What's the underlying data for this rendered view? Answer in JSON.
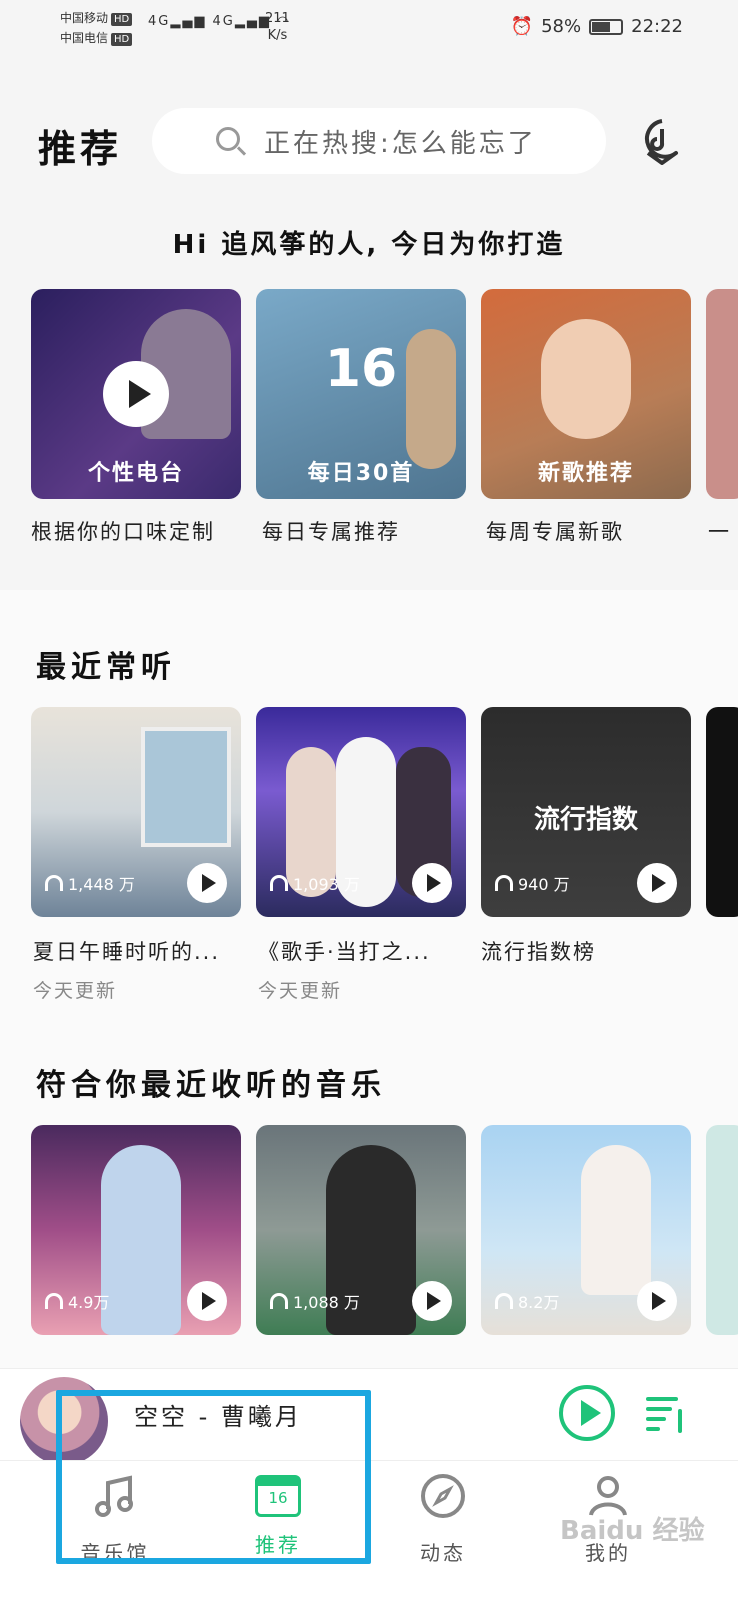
{
  "status_bar": {
    "carrier1": "中国移动",
    "carrier2": "中国电信",
    "hd": "HD",
    "net1": "4G",
    "net2": "4G",
    "speed_value": "211",
    "speed_unit": "K/s",
    "battery": "58%",
    "battery_level": 0.58,
    "time": "22:22"
  },
  "header": {
    "title": "推荐",
    "search_placeholder": "正在热搜:怎么能忘了"
  },
  "greeting": "Hi 追风筝的人, 今日为你打造",
  "daily": [
    {
      "overlay": "个性电台",
      "caption": "根据你的口味定制"
    },
    {
      "overlay": "每日30首",
      "caption": "每日专属推荐",
      "date": "16"
    },
    {
      "overlay": "新歌推荐",
      "caption": "每周专属新歌"
    }
  ],
  "recent": {
    "title": "最近常听",
    "items": [
      {
        "listens": "1,448 万",
        "caption": "夏日午睡时听的...",
        "sub": "今天更新"
      },
      {
        "listens": "1,093 万",
        "caption": "《歌手·当打之...",
        "sub": "今天更新"
      },
      {
        "listens": "940 万",
        "caption": "流行指数榜",
        "overlay": "流行指数"
      }
    ]
  },
  "matching": {
    "title": "符合你最近收听的音乐",
    "items": [
      {
        "listens": "4.9万"
      },
      {
        "listens": "1,088 万"
      },
      {
        "listens": "8.2万"
      }
    ]
  },
  "player": {
    "song": "空空 - 曹曦月"
  },
  "tabs": [
    {
      "label": "音乐馆"
    },
    {
      "label": "推荐",
      "date": "16"
    },
    {
      "label": "动态"
    },
    {
      "label": "我的"
    }
  ],
  "watermark": "Baidu 经验",
  "colors": {
    "accent": "#1fc37a",
    "highlight": "#1ba7e0"
  }
}
